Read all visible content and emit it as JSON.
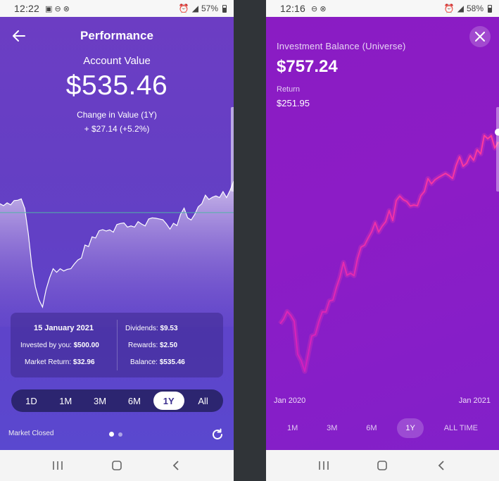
{
  "left_screen": {
    "status": {
      "time": "12:22",
      "battery": "57%"
    },
    "header": {
      "title": "Performance"
    },
    "account": {
      "label": "Account Value",
      "value": "$535.46",
      "change_label": "Change in Value (1Y)",
      "change_value": "+ $27.14 (+5.2%)"
    },
    "card": {
      "date": "15 January 2021",
      "invested_label": "Invested by you:",
      "invested_value": "$500.00",
      "market_return_label": "Market Return:",
      "market_return_value": "$32.96",
      "dividends_label": "Dividends:",
      "dividends_value": "$9.53",
      "rewards_label": "Rewards:",
      "rewards_value": "$2.50",
      "balance_label": "Balance:",
      "balance_value": "$535.46"
    },
    "ranges": [
      "1D",
      "1M",
      "3M",
      "6M",
      "1Y",
      "All"
    ],
    "active_range": "1Y",
    "footer": {
      "market_status": "Market Closed",
      "page_count": 2,
      "current_page": 1
    },
    "colors": {
      "accent": "#6a3fc4",
      "chart_fill": "#c9b5e6",
      "baseline": "#4fb3a8"
    }
  },
  "right_screen": {
    "status": {
      "time": "12:16",
      "battery": "58%"
    },
    "title": "Investment Balance (Universe)",
    "value": "$757.24",
    "return_label": "Return",
    "return_value": "$251.95",
    "x_start": "Jan 2020",
    "x_end": "Jan 2021",
    "ranges": [
      "1M",
      "3M",
      "6M",
      "1Y",
      "ALL TIME"
    ],
    "active_range": "1Y",
    "colors": {
      "background": "#8a1cc3",
      "line": "#ff3cab"
    }
  },
  "chart_data": [
    {
      "type": "area",
      "x": [
        0,
        5,
        10,
        15,
        20,
        25,
        30,
        35,
        40,
        45,
        50,
        55,
        60,
        65,
        70,
        75,
        80,
        85,
        90,
        95,
        100,
        105,
        110,
        115,
        120,
        125,
        130,
        135,
        140,
        145,
        150,
        155,
        160,
        165,
        170,
        175,
        180,
        185,
        190,
        195,
        200,
        205,
        210,
        215,
        220,
        225,
        230,
        235,
        240,
        245,
        250,
        255,
        260,
        265,
        270,
        275,
        280,
        285,
        290,
        295,
        300,
        305,
        310,
        315,
        320,
        325,
        330
      ],
      "values": [
        513.0,
        512.0,
        513.5,
        512.4,
        514.7,
        514.9,
        515.6,
        510.5,
        497.1,
        479.6,
        468.7,
        461.9,
        458.0,
        467.2,
        473.5,
        478.4,
        476.5,
        478.4,
        477.2,
        478.1,
        478.4,
        480.9,
        483.1,
        484.1,
        491.0,
        490.2,
        495.4,
        494.8,
        498.6,
        499.2,
        498.5,
        499.1,
        497.9,
        501.9,
        502.5,
        502.8,
        500.6,
        501.2,
        500.6,
        503.5,
        502.2,
        501.2,
        504.9,
        505.5,
        505.3,
        504.9,
        504.5,
        502.3,
        499.5,
        502.6,
        501.4,
        507.3,
        510.7,
        505.5,
        504.4,
        507.3,
        511.4,
        513.0,
        517.6,
        515.3,
        516.5,
        517.2,
        516.3,
        519.5,
        516.3,
        520.2,
        525.0
      ],
      "baseline": 508.32
    },
    {
      "type": "line",
      "x": [
        0,
        5,
        10,
        15,
        20,
        25,
        30,
        35,
        40,
        45,
        50,
        55,
        60,
        65,
        70,
        75,
        80,
        85,
        90,
        95,
        100,
        105,
        110,
        115,
        120,
        125,
        130,
        135,
        140,
        145,
        150,
        155,
        160,
        165,
        170,
        175,
        180,
        185,
        190,
        195,
        200,
        205,
        210,
        215,
        220,
        225,
        230,
        235,
        240,
        245,
        250,
        255,
        260,
        265,
        270,
        275,
        280,
        285,
        290,
        295,
        300,
        305,
        310
      ],
      "values": [
        527.0,
        532.9,
        542.5,
        537.6,
        530.2,
        488.4,
        479.9,
        466.8,
        489.0,
        511.4,
        513.2,
        529.3,
        542.1,
        541.9,
        555.9,
        556.9,
        573.1,
        586.1,
        604.6,
        588.4,
        590.9,
        587.9,
        609.6,
        624.2,
        626.5,
        635.4,
        643.3,
        655.1,
        643.2,
        650.6,
        656.1,
        670.2,
        657.6,
        683.0,
        688.7,
        684.0,
        681.8,
        676.1,
        677.3,
        676.4,
        689.1,
        694.5,
        710.9,
        704.2,
        709.3,
        712.3,
        714.8,
        717.4,
        714.6,
        711.0,
        727.5,
        738.5,
        726.4,
        730.2,
        739.9,
        734.0,
        747.4,
        742.0,
        765.5,
        761.3,
        765.1,
        749.5,
        757.2
      ]
    }
  ]
}
